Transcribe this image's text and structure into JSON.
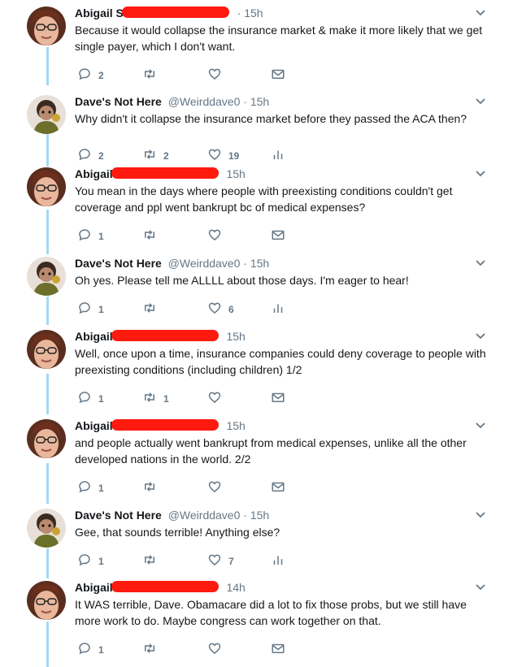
{
  "colors": {
    "rail": "#a4d8f6",
    "redaction": "#ff1a10",
    "muted": "#657786",
    "text": "#14171a"
  },
  "tweets": [
    {
      "name": "Abigail S",
      "handle": "",
      "time": "· 15h",
      "text": "Because it would collapse the insurance market & make it more likely that we get single payer, which I don't want.",
      "replies": "2",
      "retweets": "",
      "likes": "",
      "last_icon": "mail-icon"
    },
    {
      "name": "Dave's Not Here",
      "handle": "@Weirddave0",
      "time": "· 15h",
      "text": "Why didn't it collapse the insurance market before they passed the ACA then?",
      "replies": "2",
      "retweets": "2",
      "likes": "19",
      "last_icon": "analytics-icon"
    },
    {
      "name": "Abigail",
      "handle": "",
      "time": "15h",
      "text": "You mean in the days where people with preexisting conditions couldn't get coverage and ppl went bankrupt bc of medical expenses?",
      "replies": "1",
      "retweets": "",
      "likes": "",
      "last_icon": "mail-icon"
    },
    {
      "name": "Dave's Not Here",
      "handle": "@Weirddave0",
      "time": "· 15h",
      "text": "Oh yes. Please tell me ALLLL about those days. I'm eager to hear!",
      "replies": "1",
      "retweets": "",
      "likes": "6",
      "last_icon": "analytics-icon"
    },
    {
      "name": "Abigail",
      "handle": "",
      "time": "15h",
      "text": "Well, once upon a time, insurance companies could deny coverage to people with preexisting conditions (including children) 1/2",
      "replies": "1",
      "retweets": "1",
      "likes": "",
      "last_icon": "mail-icon"
    },
    {
      "name": "Abigail",
      "handle": "",
      "time": "15h",
      "text": "and people actually went bankrupt from medical expenses, unlike all the other developed nations in the world. 2/2",
      "replies": "1",
      "retweets": "",
      "likes": "",
      "last_icon": "mail-icon"
    },
    {
      "name": "Dave's Not Here",
      "handle": "@Weirddave0",
      "time": "· 15h",
      "text": "Gee, that sounds terrible! Anything else?",
      "replies": "1",
      "retweets": "",
      "likes": "7",
      "last_icon": "analytics-icon"
    },
    {
      "name": "Abigail",
      "handle": "",
      "time": "14h",
      "text": "It WAS terrible, Dave. Obamacare did a lot to fix those probs, but we still have more work to do. Maybe congress can work together on that.",
      "replies": "1",
      "retweets": "",
      "likes": "",
      "last_icon": "mail-icon"
    }
  ]
}
